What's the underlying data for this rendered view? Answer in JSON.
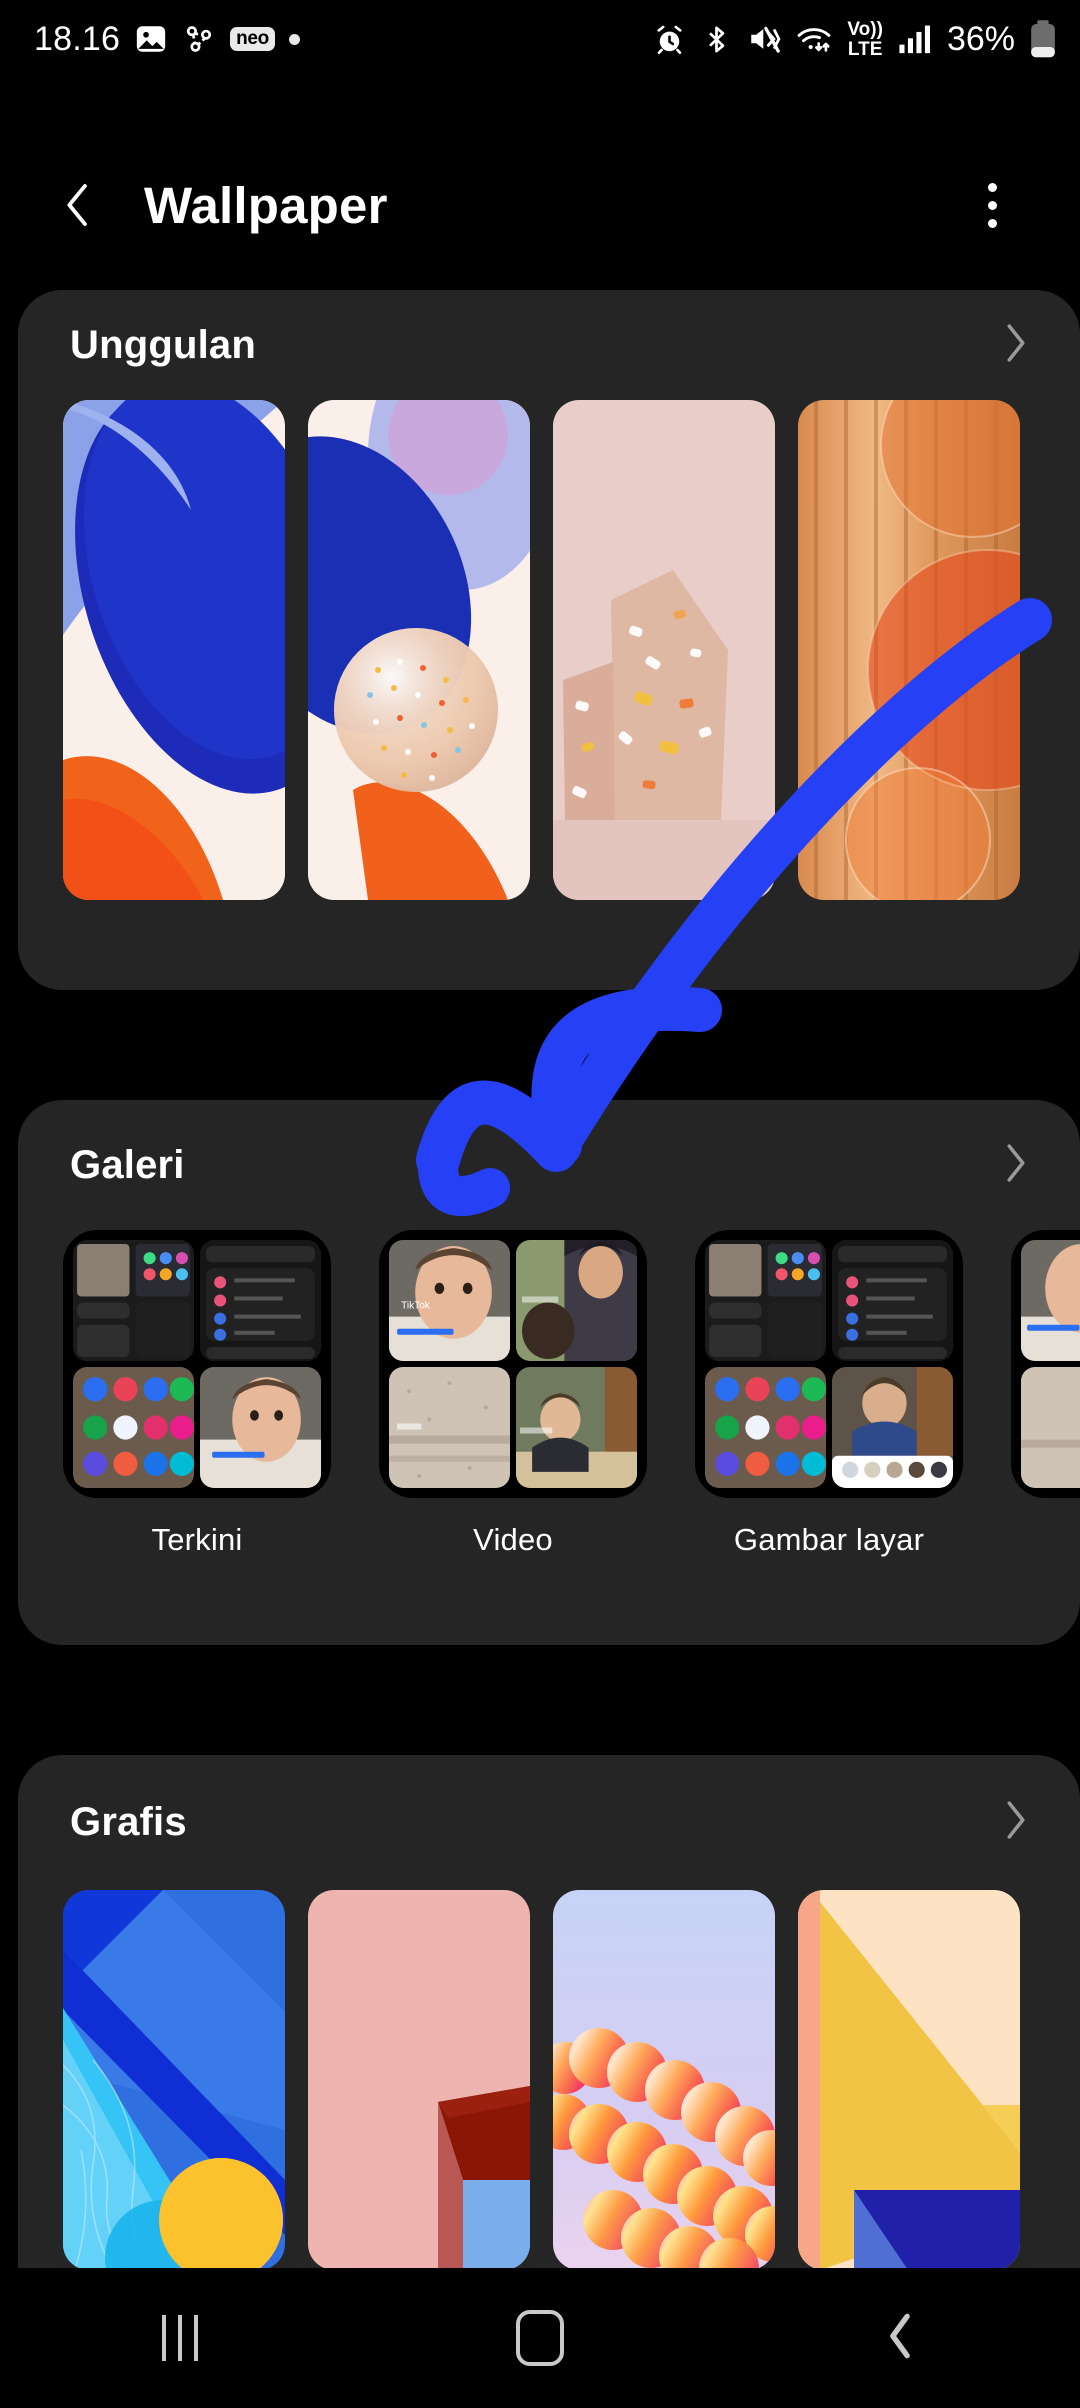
{
  "status_bar": {
    "time": "18.16",
    "left_icons": [
      "image-icon",
      "share-nearby-icon",
      "neo-app-badge",
      "dot-indicator"
    ],
    "neo_label": "neo",
    "right_icons": [
      "alarm-icon",
      "bluetooth-icon",
      "mute-vibrate-icon",
      "wifi-icon",
      "volte-icon",
      "signal-bars-icon"
    ],
    "volte_top": "Vo))",
    "volte_bottom": "LTE",
    "battery_percent": "36%"
  },
  "app_bar": {
    "back_label": "Back",
    "title": "Wallpaper",
    "menu_label": "More options"
  },
  "sections": [
    {
      "id": "unggulan",
      "title": "Unggulan",
      "chevron": "chevron-right-icon",
      "items": [
        {
          "name": "wallpaper-blue-orange"
        },
        {
          "name": "wallpaper-sphere"
        },
        {
          "name": "wallpaper-terrazzo"
        },
        {
          "name": "wallpaper-orange-columns"
        }
      ]
    },
    {
      "id": "galeri",
      "title": "Galeri",
      "chevron": "chevron-right-icon",
      "items": [
        {
          "label": "Terkini"
        },
        {
          "label": "Video"
        },
        {
          "label": "Gambar layar"
        },
        {
          "label": ""
        }
      ]
    },
    {
      "id": "grafis",
      "title": "Grafis",
      "chevron": "chevron-right-icon",
      "items": [
        {
          "name": "graphic-blue-sun"
        },
        {
          "name": "graphic-pink-arch"
        },
        {
          "name": "graphic-cloud-gradient"
        },
        {
          "name": "graphic-yellow-blue"
        }
      ]
    }
  ],
  "annotation": {
    "type": "hand-drawn-arrow",
    "color": "#2540f5",
    "points_to": "galeri"
  },
  "nav_bar": {
    "recents_label": "Recents",
    "home_label": "Home",
    "back_label": "Back"
  },
  "colors": {
    "background": "#000000",
    "card": "#252525",
    "text_primary": "#ffffff",
    "text_secondary": "#8a8a8a",
    "annotation_blue": "#2540f5"
  }
}
